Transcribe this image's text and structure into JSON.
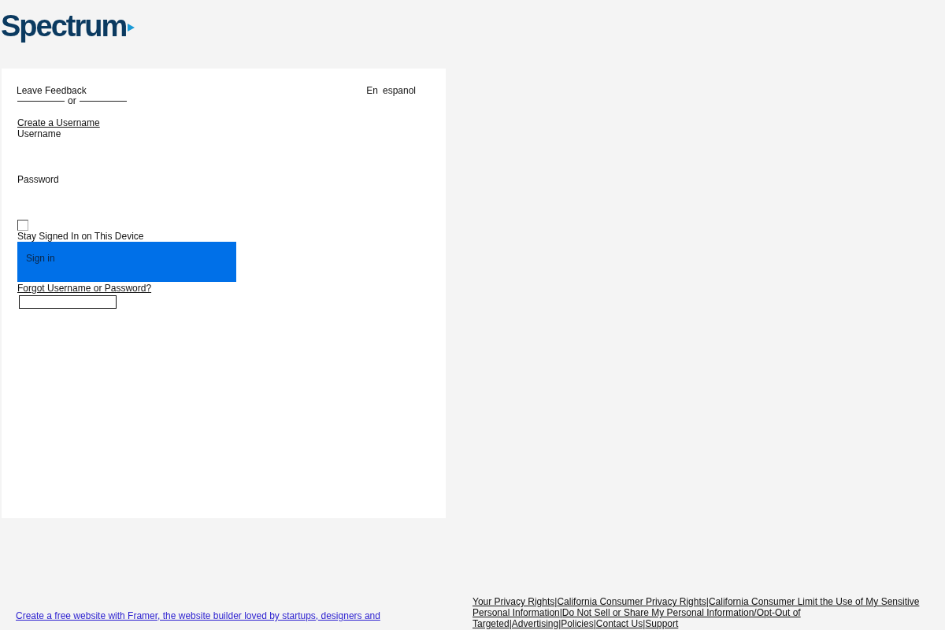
{
  "header": {
    "logo": "Spectrum"
  },
  "login_card": {
    "feedback_link": "Leave Feedback",
    "languages": [
      {
        "label": "En"
      },
      {
        "label": "espanol"
      }
    ],
    "divider_text": "or",
    "create_username_link": "Create a Username",
    "username_label": "Username",
    "password_label": "Password",
    "stay_signed_in": {
      "label": "Stay Signed In on This Device",
      "checked": false
    },
    "sign_in_button": "Sign in",
    "forgot_link": "Forgot Username or Password?"
  },
  "footer": {
    "framer_link": "Create a free website with Framer, the website builder loved by startups, designers and",
    "links": [
      {
        "label": "Your Privacy Rights",
        "separator": "|"
      },
      {
        "label": "California Consumer Privacy Rights",
        "separator": "|"
      },
      {
        "label": "California Consumer Limit the Use of My Sensitive Personal Information",
        "separator": "|"
      },
      {
        "label": "Do Not Sell or Share My Personal Information/Opt-Out of Targeted",
        "separator": "|"
      },
      {
        "label": "Advertising",
        "separator": "|"
      },
      {
        "label": "Policies",
        "separator": "|"
      },
      {
        "label": "Contact Us",
        "separator": "|"
      },
      {
        "label": "Support"
      }
    ]
  }
}
